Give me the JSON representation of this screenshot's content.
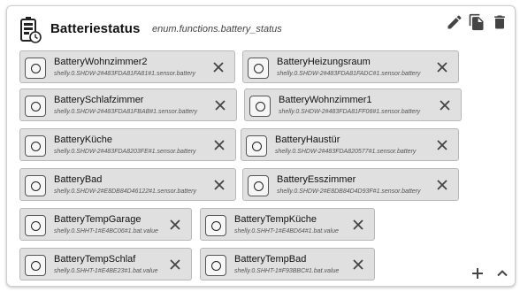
{
  "header": {
    "title": "Batteriestatus",
    "subtitle": "enum.functions.battery_status",
    "icon": "battery-status-icon"
  },
  "toolbar": {
    "icons": [
      "edit-icon",
      "copy-icon",
      "delete-icon"
    ]
  },
  "members": [
    {
      "name": "BatteryWohnzimmer2",
      "oid": "shelly.0.SHDW-2#483FDA81FA81#1.sensor.battery"
    },
    {
      "name": "BatteryHeizungsraum",
      "oid": "shelly.0.SHDW-2#483FDA81FADC#1.sensor.battery"
    },
    {
      "name": "BatterySchlafzimmer",
      "oid": "shelly.0.SHDW-2#483FDA81FBAB#1.sensor.battery"
    },
    {
      "name": "BatteryWohnzimmer1",
      "oid": "shelly.0.SHDW-2#483FDA81FF06#1.sensor.battery"
    },
    {
      "name": "BatteryKüche",
      "oid": "shelly.0.SHDW-2#483FDA8203FE#1.sensor.battery"
    },
    {
      "name": "BatteryHaustür",
      "oid": "shelly.0.SHDW-2#483FDA820577#1.sensor.battery"
    },
    {
      "name": "BatteryBad",
      "oid": "shelly.0.SHDW-2#E8DB84D46122#1.sensor.battery"
    },
    {
      "name": "BatteryEsszimmer",
      "oid": "shelly.0.SHDW-2#E8DB84D4D93F#1.sensor.battery"
    },
    {
      "name": "BatteryTempGarage",
      "oid": "shelly.0.SHHT-1#E4BC06#1.bat.value"
    },
    {
      "name": "BatteryTempKüche",
      "oid": "shelly.0.SHHT-1#E4BD64#1.bat.value"
    },
    {
      "name": "BatteryTempSchlaf",
      "oid": "shelly.0.SHHT-1#E4BE23#1.bat.value"
    },
    {
      "name": "BatteryTempBad",
      "oid": "shelly.0.SHHT-1#F93BBC#1.bat.value"
    }
  ],
  "footer": {
    "icons": [
      "add-icon",
      "collapse-icon"
    ]
  },
  "colors": {
    "chip_bg": "#e0e0e0",
    "icon": "#444444"
  }
}
